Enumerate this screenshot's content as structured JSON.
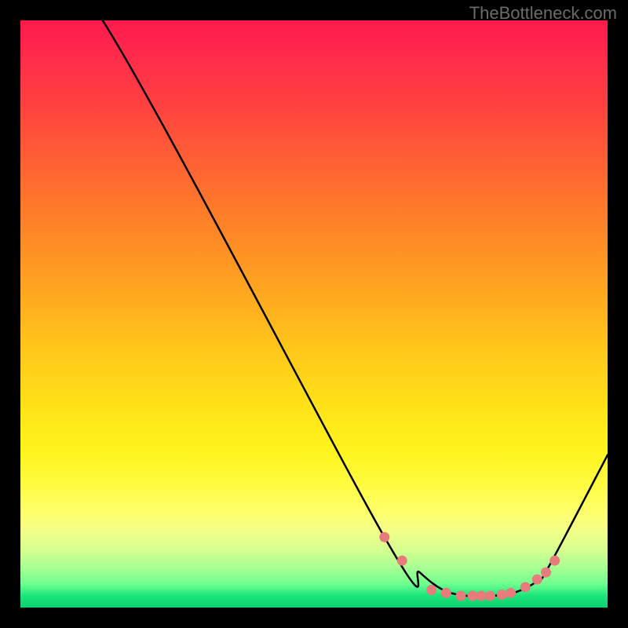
{
  "watermark": "TheBottleneck.com",
  "chart_data": {
    "type": "line",
    "title": "",
    "xlabel": "",
    "ylabel": "",
    "xlim": [
      0,
      100
    ],
    "ylim": [
      0,
      100
    ],
    "grid": false,
    "series": [
      {
        "name": "curve",
        "x": [
          0,
          14,
          62,
          68,
          72,
          76,
          80,
          84,
          88,
          90,
          100
        ],
        "values": [
          110,
          100,
          12,
          6,
          3,
          2,
          2,
          2.5,
          4.5,
          7,
          26
        ]
      }
    ],
    "markers": {
      "name": "dots",
      "color": "#e87b7b",
      "x": [
        62,
        65,
        70,
        72.5,
        75,
        77,
        78.5,
        80,
        82,
        83.5,
        86,
        88,
        89.5,
        91
      ],
      "values": [
        12,
        8,
        3,
        2.5,
        2,
        2,
        2,
        2,
        2.2,
        2.5,
        3.5,
        4.8,
        6,
        8
      ]
    },
    "background_gradient": {
      "stops": [
        {
          "pos": 0,
          "color": "#ff1a4d"
        },
        {
          "pos": 6,
          "color": "#ff2b4a"
        },
        {
          "pos": 14,
          "color": "#ff4040"
        },
        {
          "pos": 22,
          "color": "#ff5a36"
        },
        {
          "pos": 32,
          "color": "#ff7a2a"
        },
        {
          "pos": 44,
          "color": "#ffa020"
        },
        {
          "pos": 55,
          "color": "#ffc41a"
        },
        {
          "pos": 65,
          "color": "#ffe018"
        },
        {
          "pos": 73,
          "color": "#fff41c"
        },
        {
          "pos": 79,
          "color": "#fffc40"
        },
        {
          "pos": 84,
          "color": "#feff6f"
        },
        {
          "pos": 87,
          "color": "#f2ff88"
        },
        {
          "pos": 90,
          "color": "#d8ff90"
        },
        {
          "pos": 93,
          "color": "#abff93"
        },
        {
          "pos": 96,
          "color": "#6fff90"
        },
        {
          "pos": 98,
          "color": "#1ae57a"
        },
        {
          "pos": 100,
          "color": "#0cd070"
        }
      ]
    }
  }
}
